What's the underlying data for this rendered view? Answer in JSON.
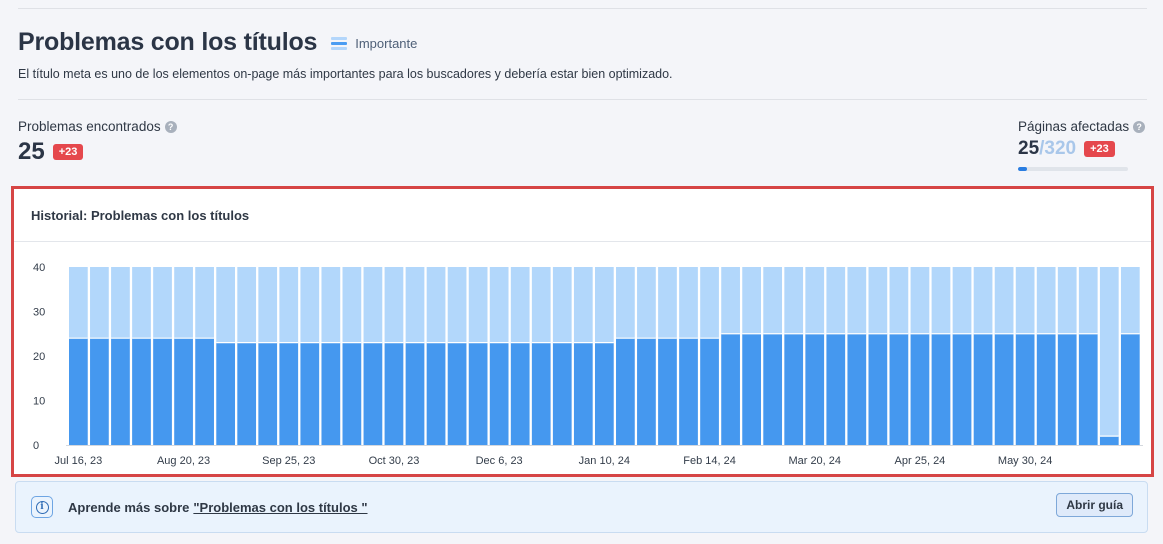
{
  "header": {
    "title": "Problemas con los títulos",
    "importance_label": "Importante",
    "importance_icon": "priority-bars-icon",
    "description": "El título meta es uno de los elementos on-page más importantes para los buscadores y debería estar bien optimizado."
  },
  "stats": {
    "issues": {
      "label": "Problemas encontrados",
      "value": "25",
      "delta": "+23"
    },
    "pages": {
      "label": "Páginas afectadas",
      "value": "25",
      "total": "320",
      "delta": "+23",
      "progress": 0.078
    }
  },
  "chart_panel": {
    "title": "Historial: Problemas con los títulos"
  },
  "chart_data": {
    "type": "bar",
    "stacked": true,
    "ylim": [
      0,
      40
    ],
    "yticks": [
      0,
      10,
      20,
      30,
      40
    ],
    "xtick_labels": [
      "Jul 16, 23",
      "Aug 20, 23",
      "Sep 25, 23",
      "Oct 30, 23",
      "Dec 6, 23",
      "Jan 10, 24",
      "Feb 14, 24",
      "Mar 20, 24",
      "Apr 25, 24",
      "May 30, 24"
    ],
    "bar_count": 51,
    "series": [
      {
        "color": "#4598ef",
        "values": [
          24,
          24,
          24,
          24,
          24,
          24,
          24,
          23,
          23,
          23,
          23,
          23,
          23,
          23,
          23,
          23,
          23,
          23,
          23,
          23,
          23,
          23,
          23,
          23,
          23,
          23,
          24,
          24,
          24,
          24,
          24,
          25,
          25,
          25,
          25,
          25,
          25,
          25,
          25,
          25,
          25,
          25,
          25,
          25,
          25,
          25,
          25,
          25,
          25,
          2,
          25
        ]
      },
      {
        "color": "#b2d7fb",
        "values": [
          16,
          16,
          16,
          16,
          16,
          16,
          16,
          17,
          17,
          17,
          17,
          17,
          17,
          17,
          17,
          17,
          17,
          17,
          17,
          17,
          17,
          17,
          17,
          17,
          17,
          17,
          16,
          16,
          16,
          16,
          16,
          15,
          15,
          15,
          15,
          15,
          15,
          15,
          15,
          15,
          15,
          15,
          15,
          15,
          15,
          15,
          15,
          15,
          15,
          38,
          15
        ]
      }
    ],
    "grid": false
  },
  "info": {
    "icon": "info-icon",
    "text": "Aprende más sobre",
    "link": "\"Problemas con los títulos \"",
    "button": "Abrir guía"
  }
}
